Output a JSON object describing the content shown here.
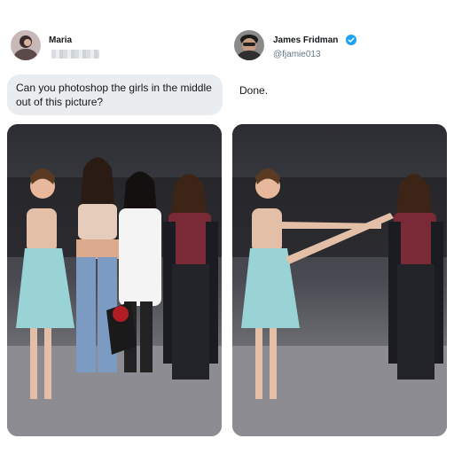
{
  "left_post": {
    "author_name": "Maria",
    "message": "Can you photoshop the girls in the middle out of this picture?",
    "avatar_icon": "user-avatar-photo",
    "handle_blurred": true
  },
  "right_post": {
    "author_name": "James Fridman",
    "handle": "@fjamie013",
    "verified_icon": "verified-badge-icon",
    "message": "Done.",
    "avatar_icon": "user-avatar-photo"
  },
  "colors": {
    "bubble_bg": "#e9edf0",
    "verified_blue": "#1da1f2",
    "handle_grey": "#657786"
  }
}
